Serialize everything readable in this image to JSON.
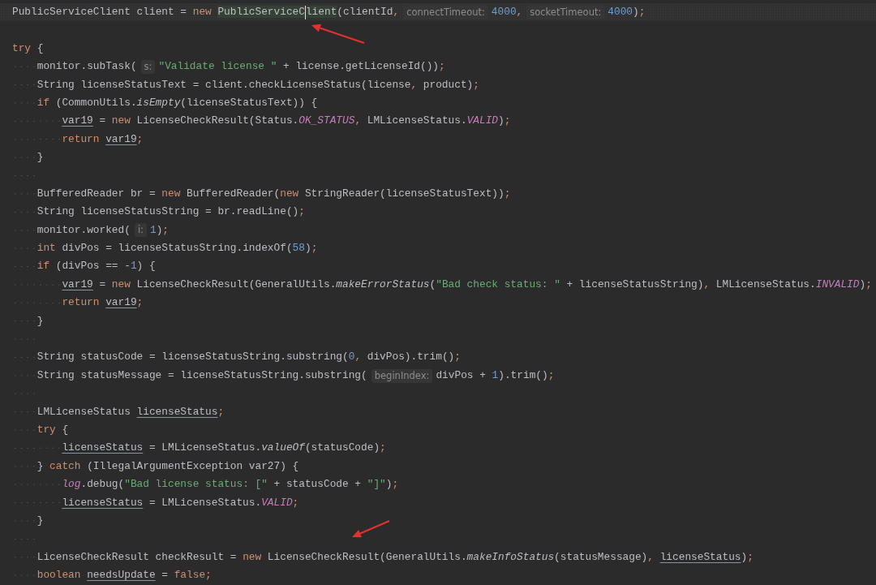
{
  "editor": {
    "lines": [
      {
        "kind": "code",
        "current": true,
        "tokens": [
          {
            "kind": "plain",
            "text": "PublicServiceClient client = "
          },
          {
            "kind": "keyword",
            "text": "new "
          },
          {
            "kind": "match",
            "text": "PublicServiceC"
          },
          {
            "kind": "caret"
          },
          {
            "kind": "match",
            "text": "lient"
          },
          {
            "kind": "plain",
            "text": "(clientId"
          },
          {
            "kind": "punct",
            "text": ","
          },
          {
            "kind": "hint",
            "text": "connectTimeout:"
          },
          {
            "kind": "number",
            "text": "4000"
          },
          {
            "kind": "punct",
            "text": ","
          },
          {
            "kind": "hint",
            "text": "socketTimeout:"
          },
          {
            "kind": "number",
            "text": "4000"
          },
          {
            "kind": "plain",
            "text": ")"
          },
          {
            "kind": "punct",
            "text": ";"
          }
        ]
      },
      {
        "kind": "blank",
        "current": false
      },
      {
        "kind": "code",
        "current": false,
        "tokens": [
          {
            "kind": "keyword",
            "text": "try"
          },
          {
            "kind": "plain",
            "text": " {"
          }
        ],
        "children": [
          {
            "kind": "code",
            "current": false,
            "tokens": [
              {
                "kind": "plain",
                "text": "monitor.subTask("
              },
              {
                "kind": "hint",
                "text": "s:"
              },
              {
                "kind": "string",
                "text": "\"Validate license \""
              },
              {
                "kind": "plain",
                "text": " + license.getLicenseId())"
              },
              {
                "kind": "punct",
                "text": ";"
              }
            ]
          },
          {
            "kind": "code",
            "current": false,
            "tokens": [
              {
                "kind": "plain",
                "text": "String licenseStatusText = client.checkLicenseStatus(license"
              },
              {
                "kind": "punct",
                "text": ","
              },
              {
                "kind": "plain",
                "text": " product)"
              },
              {
                "kind": "punct",
                "text": ";"
              }
            ]
          },
          {
            "kind": "code",
            "current": false,
            "tokens": [
              {
                "kind": "keyword",
                "text": "if"
              },
              {
                "kind": "plain",
                "text": " (CommonUtils."
              },
              {
                "kind": "static",
                "text": "isEmpty"
              },
              {
                "kind": "plain",
                "text": "(licenseStatusText)) {"
              }
            ],
            "children": [
              {
                "kind": "code",
                "current": false,
                "tokens": [
                  {
                    "kind": "reassigned",
                    "text": "var19"
                  },
                  {
                    "kind": "plain",
                    "text": " = "
                  },
                  {
                    "kind": "keyword",
                    "text": "new"
                  },
                  {
                    "kind": "plain",
                    "text": " LicenseCheckResult(Status."
                  },
                  {
                    "kind": "constant",
                    "text": "OK_STATUS"
                  },
                  {
                    "kind": "punct",
                    "text": ","
                  },
                  {
                    "kind": "plain",
                    "text": " LMLicenseStatus."
                  },
                  {
                    "kind": "constant",
                    "text": "VALID"
                  },
                  {
                    "kind": "plain",
                    "text": ")"
                  },
                  {
                    "kind": "punct",
                    "text": ";"
                  }
                ]
              },
              {
                "kind": "code",
                "current": false,
                "tokens": [
                  {
                    "kind": "keyword",
                    "text": "return "
                  },
                  {
                    "kind": "reassigned",
                    "text": "var19"
                  },
                  {
                    "kind": "punct",
                    "text": ";"
                  }
                ]
              }
            ]
          },
          {
            "kind": "code",
            "current": false,
            "tokens": [
              {
                "kind": "plain",
                "text": "}"
              }
            ]
          },
          {
            "kind": "blank",
            "current": false
          },
          {
            "kind": "code",
            "current": false,
            "tokens": [
              {
                "kind": "plain",
                "text": "BufferedReader br = "
              },
              {
                "kind": "keyword",
                "text": "new"
              },
              {
                "kind": "plain",
                "text": " BufferedReader("
              },
              {
                "kind": "keyword",
                "text": "new"
              },
              {
                "kind": "plain",
                "text": " StringReader(licenseStatusText))"
              },
              {
                "kind": "punct",
                "text": ";"
              }
            ]
          },
          {
            "kind": "code",
            "current": false,
            "tokens": [
              {
                "kind": "plain",
                "text": "String licenseStatusString = br.readLine()"
              },
              {
                "kind": "punct",
                "text": ";"
              }
            ]
          },
          {
            "kind": "code",
            "current": false,
            "tokens": [
              {
                "kind": "plain",
                "text": "monitor.worked("
              },
              {
                "kind": "hint",
                "text": "i:"
              },
              {
                "kind": "number",
                "text": "1"
              },
              {
                "kind": "plain",
                "text": ")"
              },
              {
                "kind": "punct",
                "text": ";"
              }
            ]
          },
          {
            "kind": "code",
            "current": false,
            "tokens": [
              {
                "kind": "keyword",
                "text": "int"
              },
              {
                "kind": "plain",
                "text": " divPos = licenseStatusString.indexOf("
              },
              {
                "kind": "number",
                "text": "58"
              },
              {
                "kind": "plain",
                "text": ")"
              },
              {
                "kind": "punct",
                "text": ";"
              }
            ]
          },
          {
            "kind": "code",
            "current": false,
            "tokens": [
              {
                "kind": "keyword",
                "text": "if"
              },
              {
                "kind": "plain",
                "text": " (divPos == -"
              },
              {
                "kind": "number",
                "text": "1"
              },
              {
                "kind": "plain",
                "text": ") {"
              }
            ],
            "children": [
              {
                "kind": "code",
                "current": false,
                "tokens": [
                  {
                    "kind": "reassigned",
                    "text": "var19"
                  },
                  {
                    "kind": "plain",
                    "text": " = "
                  },
                  {
                    "kind": "keyword",
                    "text": "new"
                  },
                  {
                    "kind": "plain",
                    "text": " LicenseCheckResult(GeneralUtils."
                  },
                  {
                    "kind": "static",
                    "text": "makeErrorStatus"
                  },
                  {
                    "kind": "plain",
                    "text": "("
                  },
                  {
                    "kind": "string",
                    "text": "\"Bad check status: \""
                  },
                  {
                    "kind": "plain",
                    "text": " + licenseStatusString)"
                  },
                  {
                    "kind": "punct",
                    "text": ","
                  },
                  {
                    "kind": "plain",
                    "text": " LMLicenseStatus."
                  },
                  {
                    "kind": "constant",
                    "text": "INVALID"
                  },
                  {
                    "kind": "plain",
                    "text": ")"
                  },
                  {
                    "kind": "punct",
                    "text": ";"
                  }
                ]
              },
              {
                "kind": "code",
                "current": false,
                "tokens": [
                  {
                    "kind": "keyword",
                    "text": "return "
                  },
                  {
                    "kind": "reassigned",
                    "text": "var19"
                  },
                  {
                    "kind": "punct",
                    "text": ";"
                  }
                ]
              }
            ]
          },
          {
            "kind": "code",
            "current": false,
            "tokens": [
              {
                "kind": "plain",
                "text": "}"
              }
            ]
          },
          {
            "kind": "blank",
            "current": false
          },
          {
            "kind": "code",
            "current": false,
            "tokens": [
              {
                "kind": "plain",
                "text": "String statusCode = licenseStatusString.substring("
              },
              {
                "kind": "number",
                "text": "0"
              },
              {
                "kind": "punct",
                "text": ","
              },
              {
                "kind": "plain",
                "text": " divPos).trim()"
              },
              {
                "kind": "punct",
                "text": ";"
              }
            ]
          },
          {
            "kind": "code",
            "current": false,
            "tokens": [
              {
                "kind": "plain",
                "text": "String statusMessage = licenseStatusString.substring("
              },
              {
                "kind": "hint",
                "text": "beginIndex:"
              },
              {
                "kind": "plain",
                "text": "divPos + "
              },
              {
                "kind": "number",
                "text": "1"
              },
              {
                "kind": "plain",
                "text": ").trim()"
              },
              {
                "kind": "punct",
                "text": ";"
              }
            ]
          },
          {
            "kind": "blank",
            "current": false
          },
          {
            "kind": "code",
            "current": false,
            "tokens": [
              {
                "kind": "plain",
                "text": "LMLicenseStatus "
              },
              {
                "kind": "reassigned",
                "text": "licenseStatus"
              },
              {
                "kind": "punct",
                "text": ";"
              }
            ]
          },
          {
            "kind": "code",
            "current": false,
            "tokens": [
              {
                "kind": "keyword",
                "text": "try"
              },
              {
                "kind": "plain",
                "text": " {"
              }
            ],
            "children": [
              {
                "kind": "code",
                "current": false,
                "tokens": [
                  {
                    "kind": "reassigned",
                    "text": "licenseStatus"
                  },
                  {
                    "kind": "plain",
                    "text": " = LMLicenseStatus."
                  },
                  {
                    "kind": "static",
                    "text": "valueOf"
                  },
                  {
                    "kind": "plain",
                    "text": "(statusCode)"
                  },
                  {
                    "kind": "punct",
                    "text": ";"
                  }
                ]
              }
            ]
          },
          {
            "kind": "code",
            "current": false,
            "tokens": [
              {
                "kind": "plain",
                "text": "} "
              },
              {
                "kind": "keyword",
                "text": "catch"
              },
              {
                "kind": "plain",
                "text": " (IllegalArgumentException var27) {"
              }
            ],
            "children": [
              {
                "kind": "code",
                "current": false,
                "tokens": [
                  {
                    "kind": "constant",
                    "text": "log"
                  },
                  {
                    "kind": "plain",
                    "text": ".debug("
                  },
                  {
                    "kind": "string",
                    "text": "\"Bad license status: [\""
                  },
                  {
                    "kind": "plain",
                    "text": " + statusCode + "
                  },
                  {
                    "kind": "string",
                    "text": "\"]\""
                  },
                  {
                    "kind": "plain",
                    "text": ")"
                  },
                  {
                    "kind": "punct",
                    "text": ";"
                  }
                ]
              },
              {
                "kind": "code",
                "current": false,
                "tokens": [
                  {
                    "kind": "reassigned",
                    "text": "licenseStatus"
                  },
                  {
                    "kind": "plain",
                    "text": " = LMLicenseStatus."
                  },
                  {
                    "kind": "constant",
                    "text": "VALID"
                  },
                  {
                    "kind": "punct",
                    "text": ";"
                  }
                ]
              }
            ]
          },
          {
            "kind": "code",
            "current": false,
            "tokens": [
              {
                "kind": "plain",
                "text": "}"
              }
            ]
          },
          {
            "kind": "blank",
            "current": false
          },
          {
            "kind": "code",
            "current": false,
            "tokens": [
              {
                "kind": "plain",
                "text": "LicenseCheckResult checkResult = "
              },
              {
                "kind": "keyword",
                "text": "new"
              },
              {
                "kind": "plain",
                "text": " LicenseCheckResult(GeneralUtils."
              },
              {
                "kind": "static",
                "text": "makeInfoStatus"
              },
              {
                "kind": "plain",
                "text": "(statusMessage)"
              },
              {
                "kind": "punct",
                "text": ", "
              },
              {
                "kind": "reassigned",
                "text": "licenseStatus"
              },
              {
                "kind": "plain",
                "text": ")"
              },
              {
                "kind": "punct",
                "text": ";"
              }
            ]
          },
          {
            "kind": "code",
            "current": false,
            "tokens": [
              {
                "kind": "keyword",
                "text": "boolean "
              },
              {
                "kind": "reassigned",
                "text": "needsUpdate"
              },
              {
                "kind": "plain",
                "text": " = "
              },
              {
                "kind": "keyword",
                "text": "false"
              },
              {
                "kind": "punct",
                "text": ";"
              }
            ]
          }
        ]
      }
    ]
  },
  "annotations": [
    {
      "kind": "arrow"
    },
    {
      "kind": "arrow"
    }
  ]
}
